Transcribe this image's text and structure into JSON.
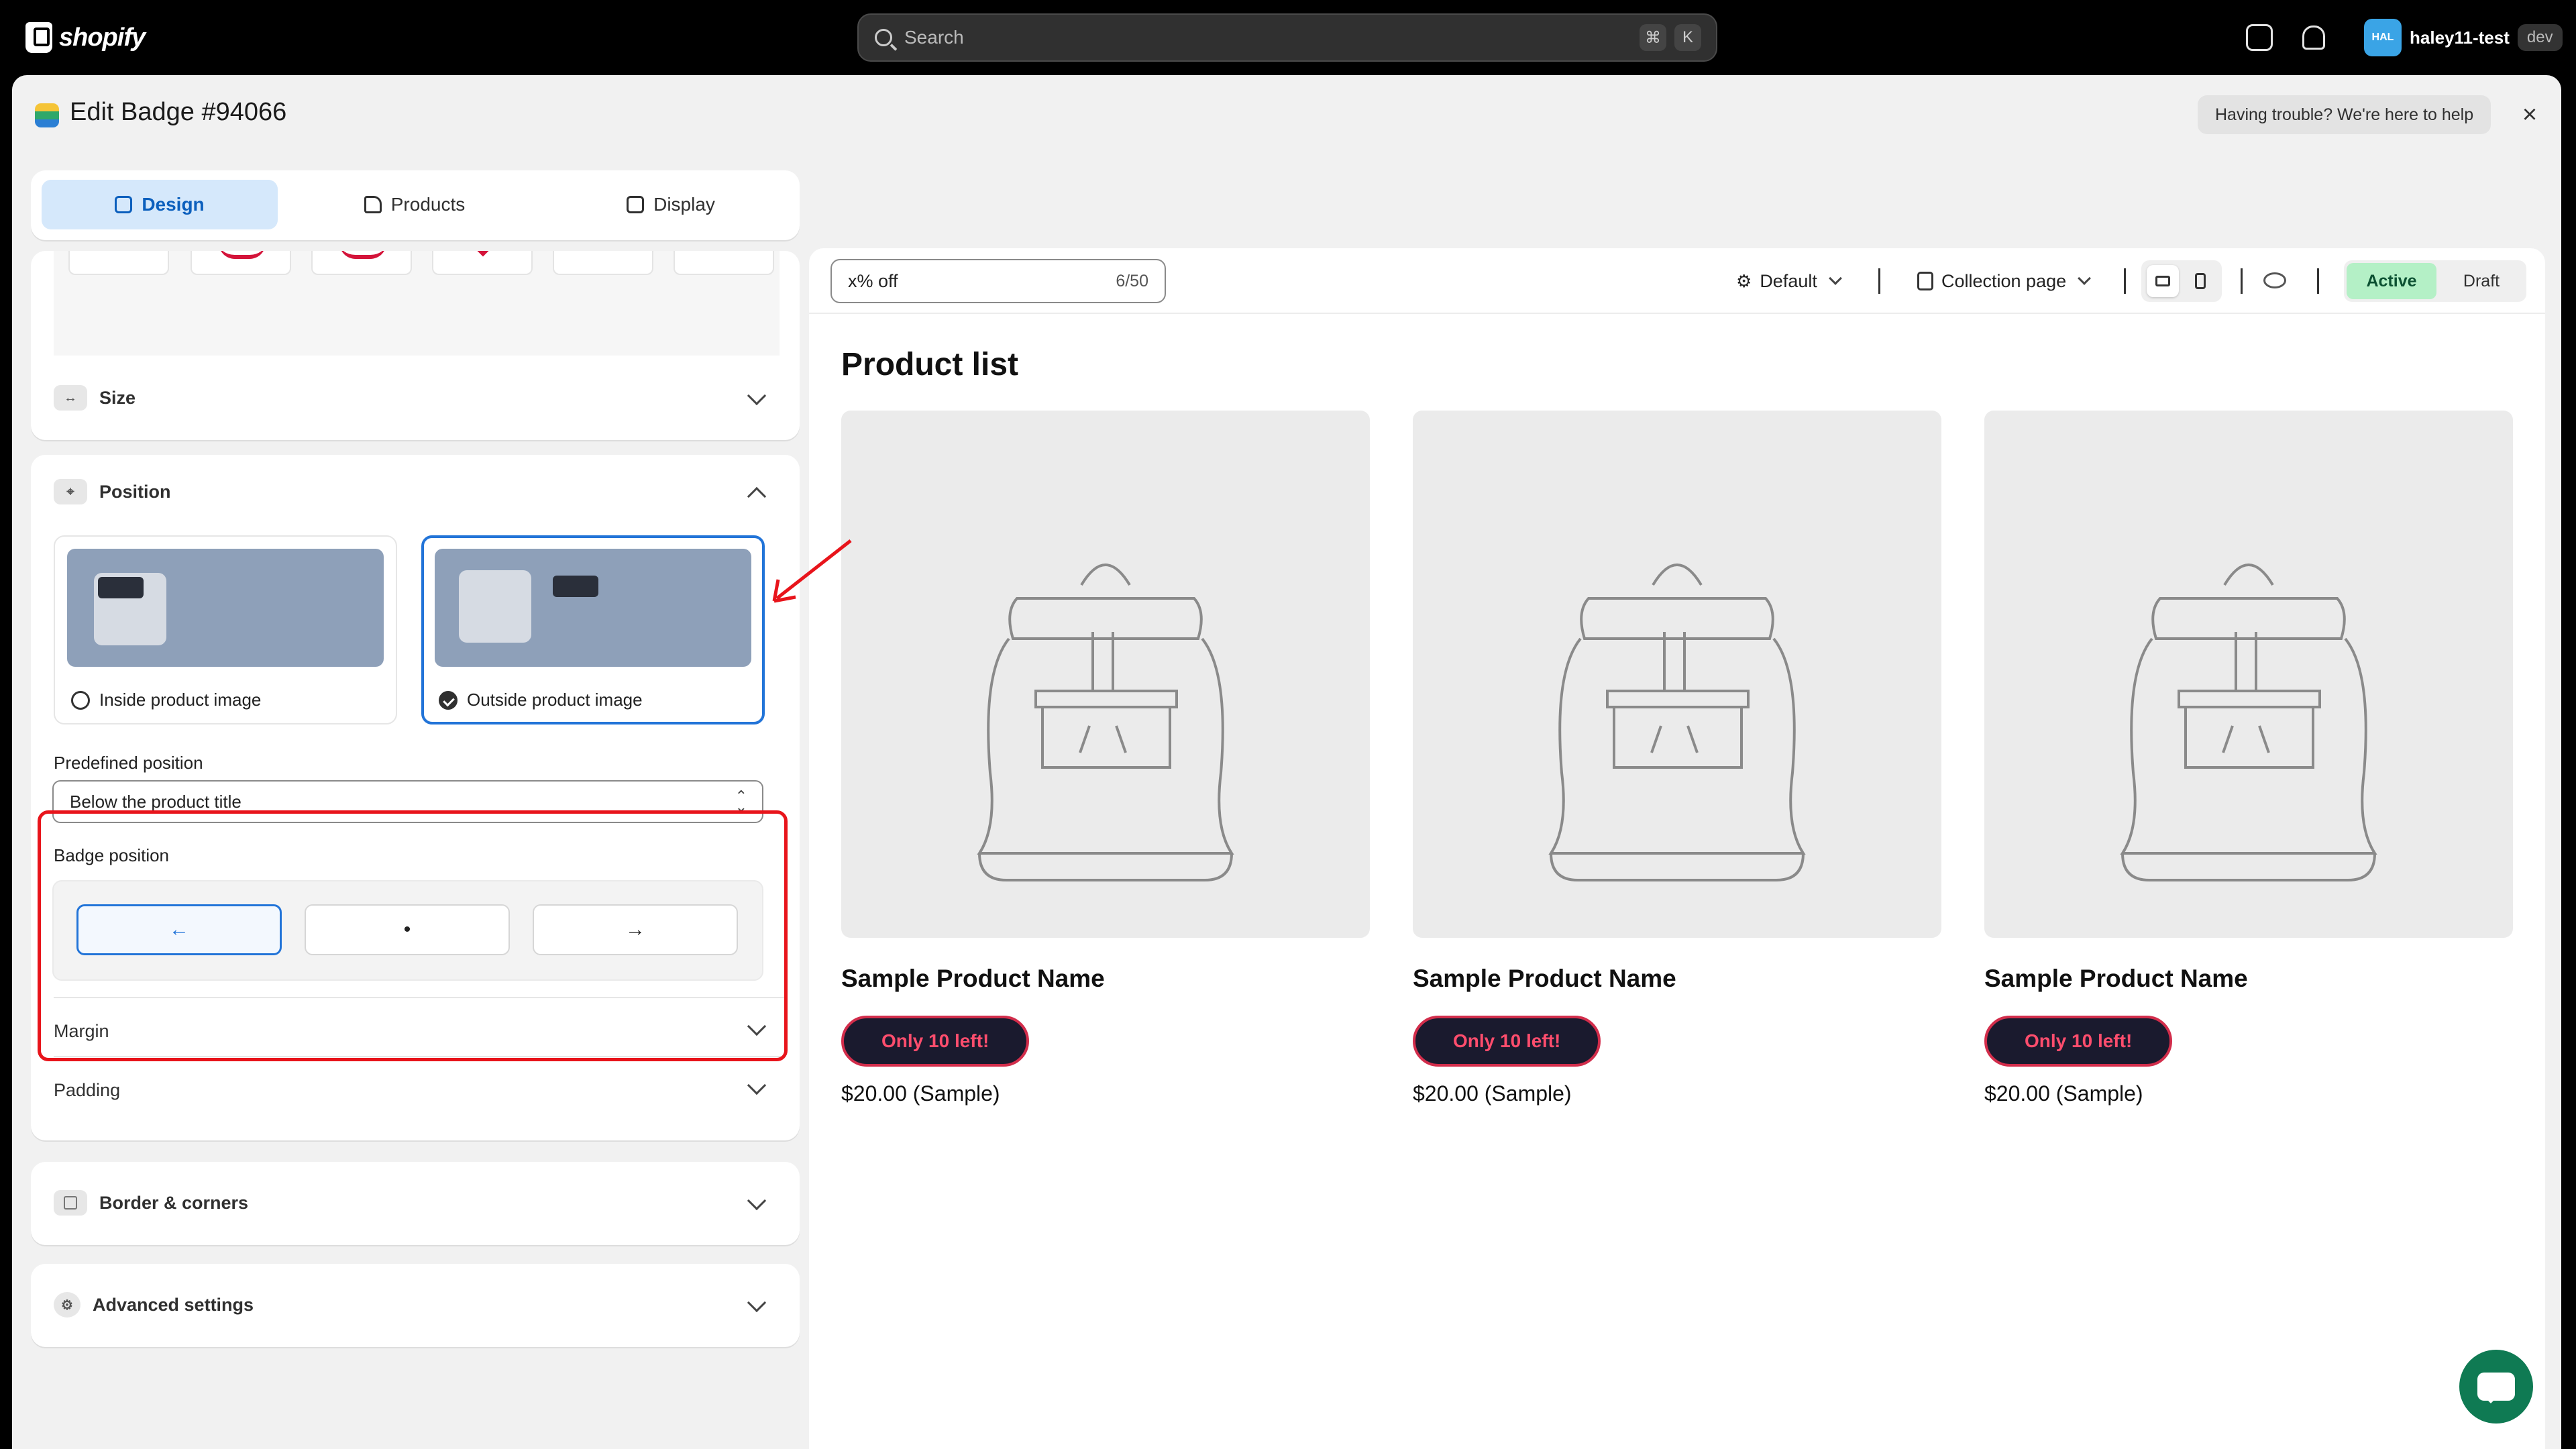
{
  "topbar": {
    "brand": "shopify",
    "search_placeholder": "Search",
    "shortcut_cmd": "⌘",
    "shortcut_key": "K",
    "user_initials": "HAL",
    "user_name": "haley11-test",
    "user_tag": "dev"
  },
  "header": {
    "title": "Edit Badge #94066",
    "help_label": "Having trouble? We're here to help",
    "close_label": "×"
  },
  "tabs": [
    {
      "label": "Design",
      "icon": "magic-wand-icon",
      "active": true
    },
    {
      "label": "Products",
      "icon": "tag-icon",
      "active": false
    },
    {
      "label": "Display",
      "icon": "image-icon",
      "active": false
    }
  ],
  "sections": {
    "size": {
      "label": "Size",
      "icon": "arrows-horizontal-icon"
    },
    "position": {
      "label": "Position",
      "icon": "crosshair-icon",
      "options": [
        {
          "label": "Inside product image",
          "selected": false
        },
        {
          "label": "Outside product image",
          "selected": true
        }
      ],
      "predefined_label": "Predefined position",
      "predefined_value": "Below the product title",
      "badge_position_label": "Badge position",
      "badge_buttons": [
        "←",
        "•",
        "→"
      ],
      "badge_selected_index": 0,
      "margin_label": "Margin",
      "padding_label": "Padding"
    },
    "border": {
      "label": "Border & corners",
      "icon": "square-icon"
    },
    "advanced": {
      "label": "Advanced settings",
      "icon": "gear-icon"
    }
  },
  "preview": {
    "badge_text": "x% off",
    "badge_count": "6/50",
    "theme_select": "Default",
    "page_select": "Collection page",
    "status_active": "Active",
    "status_draft": "Draft",
    "list_title": "Product list",
    "products": [
      {
        "name": "Sample Product Name",
        "badge": "Only 10 left!",
        "price": "$20.00 (Sample)"
      },
      {
        "name": "Sample Product Name",
        "badge": "Only 10 left!",
        "price": "$20.00 (Sample)"
      },
      {
        "name": "Sample Product Name",
        "badge": "Only 10 left!",
        "price": "$20.00 (Sample)"
      }
    ]
  },
  "colors": {
    "accent_blue": "#2274d8",
    "annotation_red": "#e8141b",
    "active_green": "#b4f0c6",
    "badge_bg": "#1a1a2e",
    "badge_text": "#ff4d6d"
  }
}
